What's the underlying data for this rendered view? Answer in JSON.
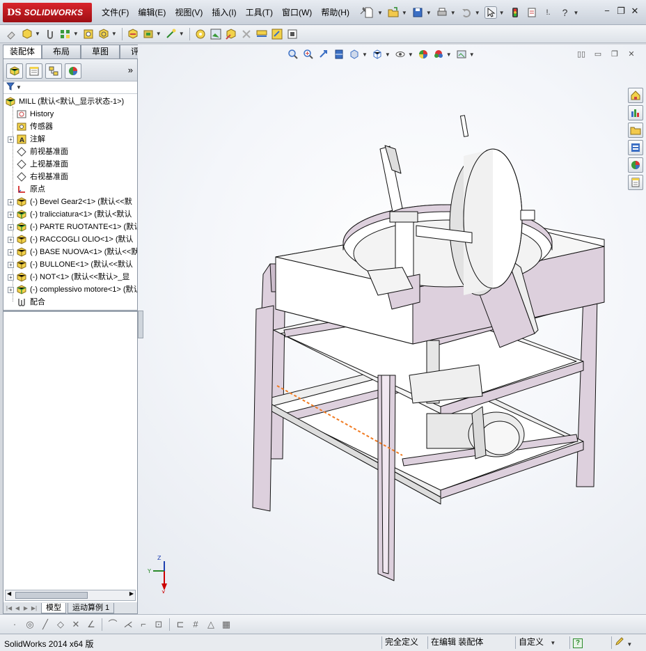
{
  "app": {
    "logo_prefix": "DS",
    "logo_name": "SOLIDWORKS"
  },
  "menu": {
    "items": [
      "文件(F)",
      "编辑(E)",
      "视图(V)",
      "插入(I)",
      "工具(T)",
      "窗口(W)",
      "帮助(H)"
    ]
  },
  "title_tools": {
    "help_glyph": "?",
    "pin_glyph": "!."
  },
  "tabs": {
    "items": [
      "装配体",
      "布局",
      "草图",
      "评估"
    ],
    "active_index": 0
  },
  "tree": {
    "root": "MILL  (默认<默认_显示状态-1>)",
    "items": [
      {
        "label": "History",
        "icon": "history-icon",
        "expandable": false
      },
      {
        "label": "传感器",
        "icon": "sensor-icon",
        "expandable": false
      },
      {
        "label": "注解",
        "icon": "annotation-icon",
        "expandable": true
      },
      {
        "label": "前视基准面",
        "icon": "plane-icon",
        "expandable": false
      },
      {
        "label": "上视基准面",
        "icon": "plane-icon",
        "expandable": false
      },
      {
        "label": "右视基准面",
        "icon": "plane-icon",
        "expandable": false
      },
      {
        "label": "原点",
        "icon": "origin-icon",
        "expandable": false
      },
      {
        "label": "(-) Bevel Gear2<1> (默认<<默",
        "icon": "part-icon",
        "expandable": true
      },
      {
        "label": "(-) tralicciatura<1> (默认<默认",
        "icon": "assembly-icon",
        "expandable": true
      },
      {
        "label": "(-) PARTE RUOTANTE<1> (默认",
        "icon": "assembly-icon",
        "expandable": true
      },
      {
        "label": "(-) RACCOGLI OLIO<1> (默认",
        "icon": "part-icon",
        "expandable": true
      },
      {
        "label": "(-) BASE NUOVA<1> (默认<<默",
        "icon": "part-icon",
        "expandable": true
      },
      {
        "label": "(-) BULLONE<1> (默认<<默认",
        "icon": "part-icon",
        "expandable": true
      },
      {
        "label": "(-) NOT<1> (默认<<默认>_显",
        "icon": "part-icon",
        "expandable": true
      },
      {
        "label": "(-) complessivo motore<1> (默认",
        "icon": "assembly-icon",
        "expandable": true
      },
      {
        "label": "配合",
        "icon": "mates-icon",
        "expandable": false
      }
    ]
  },
  "bottom_tabs": {
    "model": "模型",
    "motion": "运动算例 1"
  },
  "status": {
    "version": "SolidWorks 2014 x64 版",
    "defined": "完全定义",
    "editing": "在编辑 装配体",
    "custom": "自定义",
    "help_glyph": "?"
  },
  "colors": {
    "accent_red": "#c8161d",
    "frame_pink": "#ddd0dd"
  }
}
